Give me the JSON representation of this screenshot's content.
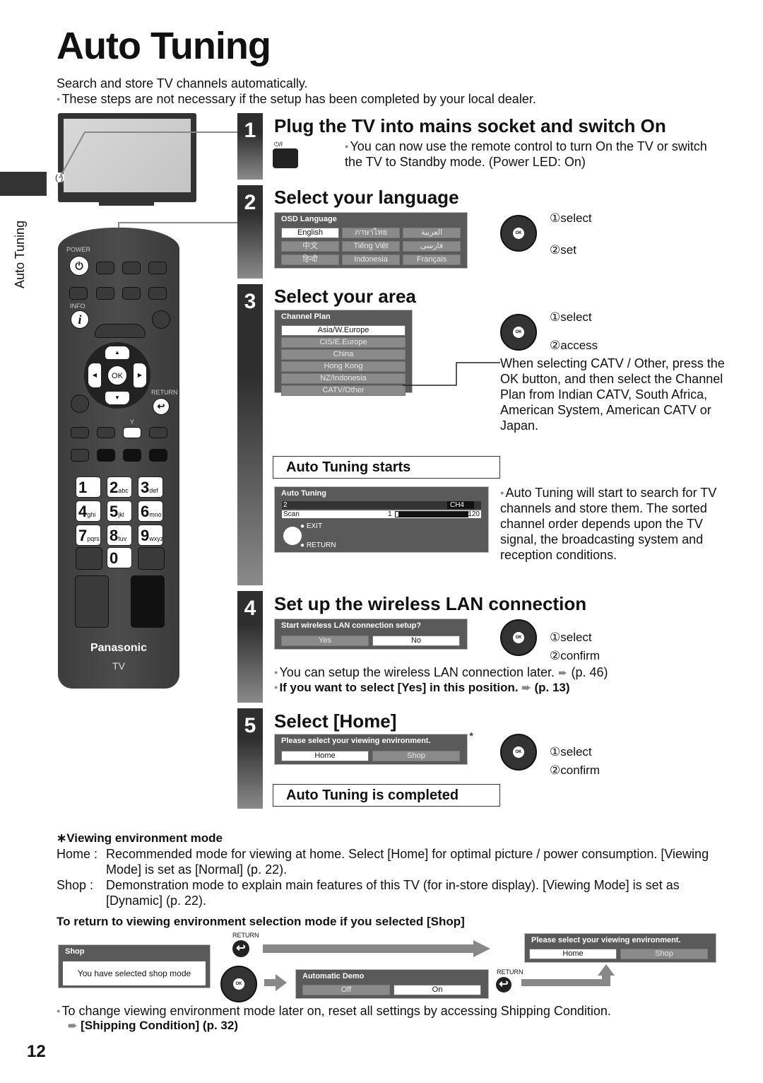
{
  "page": {
    "title": "Auto Tuning",
    "intro": "Search and store TV channels automatically.",
    "intro_note": "These steps are not necessary if the setup has been completed by your local dealer.",
    "side_tab": "Auto Tuning",
    "page_number": "12"
  },
  "tv": {
    "power_led_marker": "( )"
  },
  "remote": {
    "power_label": "POWER",
    "info_label": "INFO",
    "ok_label": "OK",
    "return_label": "RETURN",
    "y_label": "Y",
    "keys": [
      {
        "digit": "1",
        "letters": ""
      },
      {
        "digit": "2",
        "letters": "abc"
      },
      {
        "digit": "3",
        "letters": "def"
      },
      {
        "digit": "4",
        "letters": "ghi"
      },
      {
        "digit": "5",
        "letters": "jkl"
      },
      {
        "digit": "6",
        "letters": "mno"
      },
      {
        "digit": "7",
        "letters": "pqrs"
      },
      {
        "digit": "8",
        "letters": "tuv"
      },
      {
        "digit": "9",
        "letters": "wxyz"
      },
      {
        "digit": "0",
        "letters": ""
      }
    ],
    "brand": "Panasonic",
    "model": "TV"
  },
  "steps": [
    {
      "number": "1",
      "heading": "Plug the TV into mains socket and switch On",
      "power_button_label": "⏻/I",
      "note": "You can now use the remote control to turn On the TV or switch the TV to Standby mode. (Power LED: On)"
    },
    {
      "number": "2",
      "heading": "Select your language",
      "osd_title": "OSD Language",
      "options": [
        "English",
        "ภาษาไทย",
        "العربية",
        "中文",
        "Tiếng Việt",
        "فارسی",
        "हिन्दी",
        "Indonesia",
        "Français"
      ],
      "selected": "English",
      "action1": "select",
      "action2": "set"
    },
    {
      "number": "3",
      "heading": "Select your area",
      "osd_title": "Channel Plan",
      "options": [
        "Asia/W.Europe",
        "CIS/E.Europe",
        "China",
        "Hong Kong",
        "NZ/Indonesia",
        "CATV/Other"
      ],
      "selected": "Asia/W.Europe",
      "action1": "select",
      "action2": "access",
      "catv_note": "When selecting CATV / Other, press the OK button, and then select the Channel Plan from Indian CATV, South Africa, American System, American CATV or Japan.",
      "starts_label": "Auto Tuning starts",
      "tuning_osd": {
        "title": "Auto Tuning",
        "channel_num": "2",
        "channel_name": "CH4",
        "scan_label": "Scan",
        "scan_start": "1",
        "scan_end": "120",
        "progress_fraction": 0.02,
        "exit_label": "EXIT",
        "return_label": "RETURN"
      },
      "tuning_note": "Auto Tuning will start to search for TV channels and store them. The sorted channel order depends upon the TV signal, the broadcasting system and reception conditions."
    },
    {
      "number": "4",
      "heading": "Set up the wireless LAN connection",
      "osd_title": "Start wireless LAN connection setup?",
      "options": [
        "Yes",
        "No"
      ],
      "selected": "No",
      "action1": "select",
      "action2": "confirm",
      "note1": "You can setup the wireless LAN connection later.",
      "note1_ref": "(p. 46)",
      "note2": "If you want to select [Yes] in this position.",
      "note2_ref": "(p. 13)"
    },
    {
      "number": "5",
      "heading": "Select [Home]",
      "osd_title": "Please select your viewing environment.",
      "options": [
        "Home",
        "Shop"
      ],
      "selected": "Home",
      "asterisk": "*",
      "action1": "select",
      "action2": "confirm",
      "completed_label": "Auto Tuning is completed"
    }
  ],
  "viewing_env": {
    "heading": "∗Viewing environment mode",
    "home_term": "Home :",
    "home_desc": "Recommended mode for viewing at home. Select [Home] for optimal picture / power consumption. [Viewing Mode] is set as [Normal] (p. 22).",
    "shop_term": "Shop  :",
    "shop_desc": "Demonstration mode to explain main features of this TV (for in-store display). [Viewing Mode] is set as [Dynamic] (p. 22).",
    "return_heading": "To return to viewing environment selection mode if you selected [Shop]",
    "shop_osd_title": "Shop",
    "shop_osd_msg": "You have selected shop mode",
    "return_label": "RETURN",
    "demo_osd_title": "Automatic Demo",
    "demo_options": [
      "Off",
      "On"
    ],
    "demo_selected": "On",
    "select_osd_title": "Please select your viewing environment.",
    "select_options": [
      "Home",
      "Shop"
    ],
    "select_selected": "Home",
    "change_note": "To change viewing environment mode later on, reset all settings by accessing Shipping Condition.",
    "change_ref": "[Shipping Condition] (p. 32)"
  }
}
